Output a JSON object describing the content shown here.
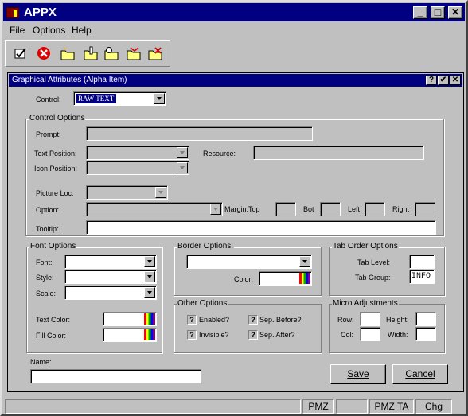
{
  "window": {
    "title": "APPX"
  },
  "titlebar_buttons": {
    "minimize": "_",
    "maximize": "□",
    "close": "✕"
  },
  "menu": [
    {
      "label": "File"
    },
    {
      "label": "Options"
    },
    {
      "label": "Help"
    }
  ],
  "toolbar": [
    {
      "icon": "check-doc-icon"
    },
    {
      "icon": "cancel-icon",
      "color": "#e00000"
    },
    {
      "icon": "new-folder-icon"
    },
    {
      "icon": "edit-folder-icon"
    },
    {
      "icon": "find-folder-icon"
    },
    {
      "icon": "export-folder-icon"
    },
    {
      "icon": "delete-folder-icon"
    }
  ],
  "dialog": {
    "title": "Graphical Attributes (Alpha Item)",
    "buttons": {
      "help": "?",
      "ok": "✔",
      "close": "✕"
    },
    "control": {
      "label": "Control:",
      "value": "RAW TEXT"
    },
    "control_options": {
      "title": "Control Options",
      "prompt": "Prompt:",
      "text_position": "Text Position:",
      "resource": "Resource:",
      "icon_position": "Icon Position:",
      "picture_loc": "Picture Loc:",
      "option": "Option:",
      "margin_top": "Margin:Top",
      "bot": "Bot",
      "left": "Left",
      "right": "Right",
      "tooltip": "Tooltip:"
    },
    "font_options": {
      "title": "Font Options",
      "font": "Font:",
      "style": "Style:",
      "scale": "Scale:",
      "text_color": "Text Color:",
      "fill_color": "Fill Color:"
    },
    "border_options": {
      "title": "Border Options:",
      "color": "Color:"
    },
    "tab_order": {
      "title": "Tab Order Options",
      "tab_level": "Tab Level:",
      "tab_group": "Tab Group:",
      "tab_group_value": "INFO"
    },
    "other_options": {
      "title": "Other Options",
      "enabled": "Enabled?",
      "invisible": "Invisible?",
      "sep_before": "Sep. Before?",
      "sep_after": "Sep. After?",
      "check_mark": "?"
    },
    "micro": {
      "title": "Micro Adjustments",
      "row": "Row:",
      "height": "Height:",
      "col": "Col:",
      "width": "Width:"
    },
    "name_label": "Name:",
    "save": "Save",
    "cancel": "Cancel"
  },
  "status": [
    "PMZ",
    "PMZ TA",
    "Chg"
  ]
}
